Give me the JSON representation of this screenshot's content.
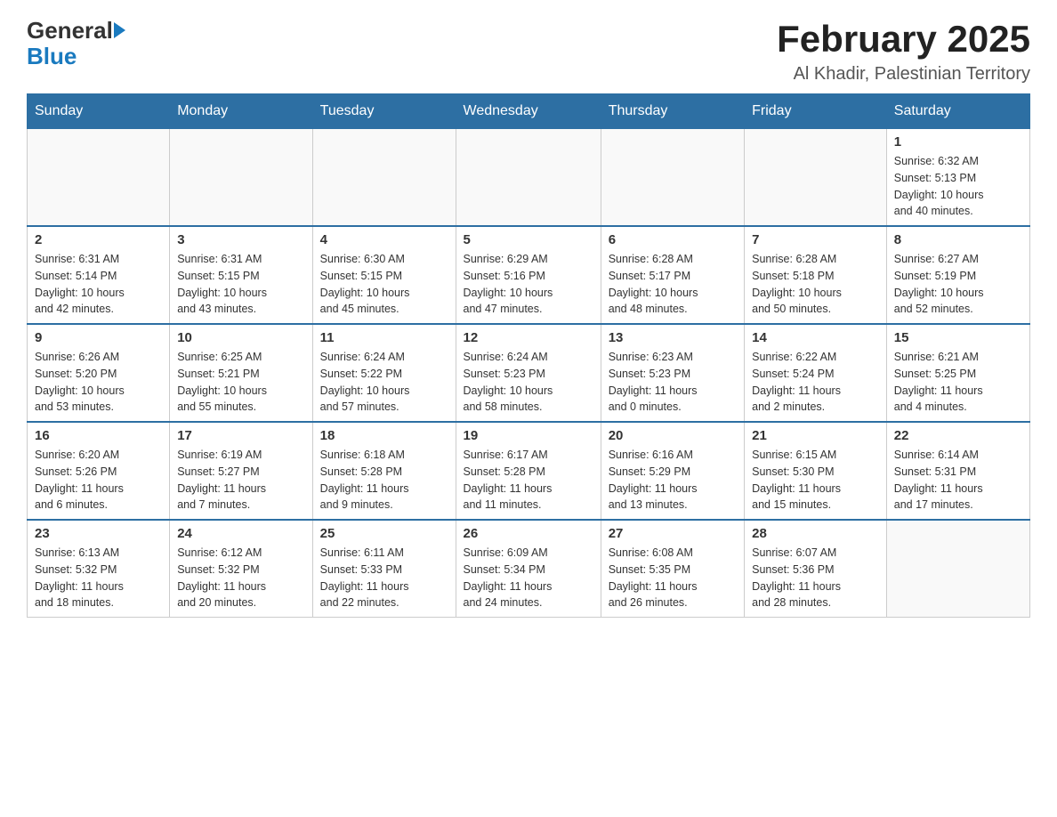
{
  "header": {
    "logo_general": "General",
    "logo_blue": "Blue",
    "main_title": "February 2025",
    "subtitle": "Al Khadir, Palestinian Territory"
  },
  "weekdays": [
    "Sunday",
    "Monday",
    "Tuesday",
    "Wednesday",
    "Thursday",
    "Friday",
    "Saturday"
  ],
  "weeks": [
    [
      {
        "day": "",
        "info": ""
      },
      {
        "day": "",
        "info": ""
      },
      {
        "day": "",
        "info": ""
      },
      {
        "day": "",
        "info": ""
      },
      {
        "day": "",
        "info": ""
      },
      {
        "day": "",
        "info": ""
      },
      {
        "day": "1",
        "info": "Sunrise: 6:32 AM\nSunset: 5:13 PM\nDaylight: 10 hours\nand 40 minutes."
      }
    ],
    [
      {
        "day": "2",
        "info": "Sunrise: 6:31 AM\nSunset: 5:14 PM\nDaylight: 10 hours\nand 42 minutes."
      },
      {
        "day": "3",
        "info": "Sunrise: 6:31 AM\nSunset: 5:15 PM\nDaylight: 10 hours\nand 43 minutes."
      },
      {
        "day": "4",
        "info": "Sunrise: 6:30 AM\nSunset: 5:15 PM\nDaylight: 10 hours\nand 45 minutes."
      },
      {
        "day": "5",
        "info": "Sunrise: 6:29 AM\nSunset: 5:16 PM\nDaylight: 10 hours\nand 47 minutes."
      },
      {
        "day": "6",
        "info": "Sunrise: 6:28 AM\nSunset: 5:17 PM\nDaylight: 10 hours\nand 48 minutes."
      },
      {
        "day": "7",
        "info": "Sunrise: 6:28 AM\nSunset: 5:18 PM\nDaylight: 10 hours\nand 50 minutes."
      },
      {
        "day": "8",
        "info": "Sunrise: 6:27 AM\nSunset: 5:19 PM\nDaylight: 10 hours\nand 52 minutes."
      }
    ],
    [
      {
        "day": "9",
        "info": "Sunrise: 6:26 AM\nSunset: 5:20 PM\nDaylight: 10 hours\nand 53 minutes."
      },
      {
        "day": "10",
        "info": "Sunrise: 6:25 AM\nSunset: 5:21 PM\nDaylight: 10 hours\nand 55 minutes."
      },
      {
        "day": "11",
        "info": "Sunrise: 6:24 AM\nSunset: 5:22 PM\nDaylight: 10 hours\nand 57 minutes."
      },
      {
        "day": "12",
        "info": "Sunrise: 6:24 AM\nSunset: 5:23 PM\nDaylight: 10 hours\nand 58 minutes."
      },
      {
        "day": "13",
        "info": "Sunrise: 6:23 AM\nSunset: 5:23 PM\nDaylight: 11 hours\nand 0 minutes."
      },
      {
        "day": "14",
        "info": "Sunrise: 6:22 AM\nSunset: 5:24 PM\nDaylight: 11 hours\nand 2 minutes."
      },
      {
        "day": "15",
        "info": "Sunrise: 6:21 AM\nSunset: 5:25 PM\nDaylight: 11 hours\nand 4 minutes."
      }
    ],
    [
      {
        "day": "16",
        "info": "Sunrise: 6:20 AM\nSunset: 5:26 PM\nDaylight: 11 hours\nand 6 minutes."
      },
      {
        "day": "17",
        "info": "Sunrise: 6:19 AM\nSunset: 5:27 PM\nDaylight: 11 hours\nand 7 minutes."
      },
      {
        "day": "18",
        "info": "Sunrise: 6:18 AM\nSunset: 5:28 PM\nDaylight: 11 hours\nand 9 minutes."
      },
      {
        "day": "19",
        "info": "Sunrise: 6:17 AM\nSunset: 5:28 PM\nDaylight: 11 hours\nand 11 minutes."
      },
      {
        "day": "20",
        "info": "Sunrise: 6:16 AM\nSunset: 5:29 PM\nDaylight: 11 hours\nand 13 minutes."
      },
      {
        "day": "21",
        "info": "Sunrise: 6:15 AM\nSunset: 5:30 PM\nDaylight: 11 hours\nand 15 minutes."
      },
      {
        "day": "22",
        "info": "Sunrise: 6:14 AM\nSunset: 5:31 PM\nDaylight: 11 hours\nand 17 minutes."
      }
    ],
    [
      {
        "day": "23",
        "info": "Sunrise: 6:13 AM\nSunset: 5:32 PM\nDaylight: 11 hours\nand 18 minutes."
      },
      {
        "day": "24",
        "info": "Sunrise: 6:12 AM\nSunset: 5:32 PM\nDaylight: 11 hours\nand 20 minutes."
      },
      {
        "day": "25",
        "info": "Sunrise: 6:11 AM\nSunset: 5:33 PM\nDaylight: 11 hours\nand 22 minutes."
      },
      {
        "day": "26",
        "info": "Sunrise: 6:09 AM\nSunset: 5:34 PM\nDaylight: 11 hours\nand 24 minutes."
      },
      {
        "day": "27",
        "info": "Sunrise: 6:08 AM\nSunset: 5:35 PM\nDaylight: 11 hours\nand 26 minutes."
      },
      {
        "day": "28",
        "info": "Sunrise: 6:07 AM\nSunset: 5:36 PM\nDaylight: 11 hours\nand 28 minutes."
      },
      {
        "day": "",
        "info": ""
      }
    ]
  ]
}
